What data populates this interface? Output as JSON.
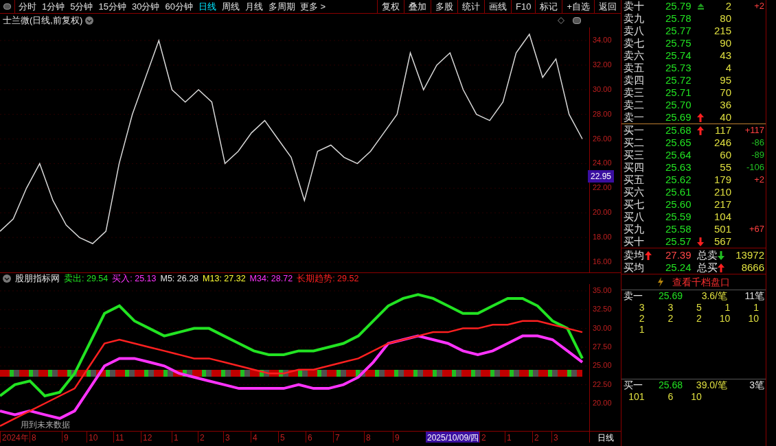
{
  "toolbar": {
    "periods": [
      {
        "label": "分时",
        "selected": false
      },
      {
        "label": "1分钟",
        "selected": false
      },
      {
        "label": "5分钟",
        "selected": false
      },
      {
        "label": "15分钟",
        "selected": false
      },
      {
        "label": "30分钟",
        "selected": false
      },
      {
        "label": "60分钟",
        "selected": false
      },
      {
        "label": "日线",
        "selected": true
      },
      {
        "label": "周线",
        "selected": false
      },
      {
        "label": "月线",
        "selected": false
      },
      {
        "label": "多周期",
        "selected": false
      }
    ],
    "more": "更多 >",
    "actions": [
      "复权",
      "叠加",
      "多股",
      "统计",
      "画线",
      "F10",
      "标记",
      "+自选",
      "返回"
    ]
  },
  "chart": {
    "title": "士兰微(日线,前复权)",
    "price_tag": "22.95",
    "chart_data": {
      "type": "line",
      "grid": true,
      "ylim": [
        15.16,
        35.06
      ],
      "yticks": [
        {
          "value": 16,
          "label": "16.00"
        },
        {
          "value": 18,
          "label": "18.00"
        },
        {
          "value": 20,
          "label": "20.00"
        },
        {
          "value": 22,
          "label": "22.00"
        },
        {
          "value": 24,
          "label": "24.00"
        },
        {
          "value": 26,
          "label": "26.00"
        },
        {
          "value": 28,
          "label": "28.00"
        },
        {
          "value": 30,
          "label": "30.00"
        },
        {
          "value": 32,
          "label": "32.00"
        },
        {
          "value": 34,
          "label": "34.00"
        }
      ],
      "series": [
        {
          "color": "#d8d8d8",
          "values": [
            18.5,
            19.5,
            22,
            24,
            21,
            19,
            18,
            17.5,
            18.5,
            24,
            28,
            31,
            34,
            30,
            29,
            30,
            29,
            24,
            25,
            26.5,
            27.5,
            26,
            24.5,
            21,
            25,
            25.5,
            24.5,
            24,
            25,
            26.5,
            28,
            33,
            30,
            32,
            33,
            30,
            28,
            27.5,
            29,
            33,
            34.5,
            31,
            32.5,
            28,
            26
          ]
        }
      ]
    }
  },
  "indicator": {
    "name": "股朋指标网",
    "readings": [
      {
        "label": "卖出: 29.54",
        "color": "#22e322"
      },
      {
        "label": "买入: 25.13",
        "color": "#ff33ff"
      },
      {
        "label": "M5: 26.28",
        "color": "#e8e8e8"
      },
      {
        "label": "M13: 27.32",
        "color": "#ffff33"
      },
      {
        "label": "M34: 28.72",
        "color": "#ff33ff"
      },
      {
        "label": "长期趋势: 29.52",
        "color": "#ff2020"
      }
    ],
    "note": "用到未来数据",
    "chart_data": {
      "type": "line",
      "grid": true,
      "ylim": [
        16.34,
        35.91
      ],
      "yticks": [
        {
          "value": 20,
          "label": "20.00"
        },
        {
          "value": 22.5,
          "label": "22.50"
        },
        {
          "value": 25,
          "label": "25.00"
        },
        {
          "value": 27.5,
          "label": "27.50"
        },
        {
          "value": 30,
          "label": "30.00"
        },
        {
          "value": 32.5,
          "label": "32.50"
        },
        {
          "value": 35,
          "label": "35.00"
        }
      ],
      "series": [
        {
          "color": "#22e322",
          "values": [
            21,
            22.5,
            23,
            21,
            21.5,
            24,
            28,
            32,
            33,
            31,
            30,
            29,
            29.5,
            30,
            30,
            29,
            28,
            27,
            26.5,
            26.5,
            27,
            27,
            27.5,
            28,
            29,
            31,
            33,
            34,
            34.5,
            34,
            33,
            32,
            32,
            33,
            34,
            34,
            33,
            31,
            30,
            26
          ]
        },
        {
          "color": "#ff33ff",
          "values": [
            19,
            18.5,
            19,
            18.5,
            18,
            19,
            22,
            25,
            26,
            26,
            25.5,
            25,
            24,
            23.5,
            23,
            22.5,
            22,
            22,
            22,
            22,
            22.5,
            22,
            22,
            22.5,
            23.5,
            25.5,
            28,
            28.5,
            29,
            28.5,
            28,
            27,
            26.5,
            27,
            28,
            29,
            29,
            28.5,
            27,
            25.5
          ]
        },
        {
          "color": "#ff2020",
          "values": [
            17,
            18,
            19,
            20,
            21,
            22,
            25,
            28,
            28.5,
            28,
            27.5,
            27,
            26.5,
            26,
            26,
            25.5,
            25,
            24.5,
            24,
            24,
            24.5,
            24.5,
            25,
            25.5,
            26,
            27,
            28,
            28.5,
            29,
            29.5,
            29.5,
            30,
            30,
            30.5,
            30.5,
            31,
            31,
            30.5,
            30,
            29.5
          ]
        }
      ]
    }
  },
  "x_axis": {
    "labels": [
      "2024年",
      "8",
      "9",
      "10",
      "11",
      "12",
      "1",
      "2",
      "3",
      "4",
      "5",
      "6",
      "7",
      "8",
      "9"
    ],
    "cursor_date": "2025/10/09/四",
    "labels_after": [
      "2",
      "1",
      "2",
      "3"
    ],
    "period": "日线"
  },
  "order_book": {
    "asks": [
      {
        "label": "卖十",
        "price": "25.79",
        "volume": "2",
        "change": "+2",
        "color": "#ff4040",
        "arrow": {
          "kind": "flat",
          "color": "#1e9a1e"
        }
      },
      {
        "label": "卖九",
        "price": "25.78",
        "volume": "80"
      },
      {
        "label": "卖八",
        "price": "25.77",
        "volume": "215"
      },
      {
        "label": "卖七",
        "price": "25.75",
        "volume": "90"
      },
      {
        "label": "卖六",
        "price": "25.74",
        "volume": "43"
      },
      {
        "label": "卖五",
        "price": "25.73",
        "volume": "4"
      },
      {
        "label": "卖四",
        "price": "25.72",
        "volume": "95"
      },
      {
        "label": "卖三",
        "price": "25.71",
        "volume": "70"
      },
      {
        "label": "卖二",
        "price": "25.70",
        "volume": "36"
      },
      {
        "label": "卖一",
        "price": "25.69",
        "volume": "40",
        "arrow": {
          "kind": "up",
          "color": "#ff2020"
        }
      }
    ],
    "bids": [
      {
        "label": "买一",
        "price": "25.68",
        "volume": "117",
        "change": "+117",
        "color": "#ff4040",
        "arrow": {
          "kind": "up",
          "color": "#ff2020"
        }
      },
      {
        "label": "买二",
        "price": "25.65",
        "volume": "246",
        "change": "-86",
        "color": "#22c022"
      },
      {
        "label": "买三",
        "price": "25.64",
        "volume": "60",
        "change": "-89",
        "color": "#22c022"
      },
      {
        "label": "买四",
        "price": "25.63",
        "volume": "55",
        "change": "-106",
        "color": "#22c022"
      },
      {
        "label": "买五",
        "price": "25.62",
        "volume": "179",
        "change": "+2",
        "color": "#ff4040"
      },
      {
        "label": "买六",
        "price": "25.61",
        "volume": "210"
      },
      {
        "label": "买七",
        "price": "25.60",
        "volume": "217"
      },
      {
        "label": "买八",
        "price": "25.59",
        "volume": "104"
      },
      {
        "label": "买九",
        "price": "25.58",
        "volume": "501",
        "change": "+67",
        "color": "#ff4040"
      },
      {
        "label": "买十",
        "price": "25.57",
        "volume": "567",
        "arrow": {
          "kind": "down",
          "color": "#ff2020"
        }
      }
    ],
    "summary": [
      {
        "label": "卖均",
        "arrow": {
          "kind": "up",
          "color": "#ff2020"
        },
        "value": "27.39",
        "color": "#ff4848",
        "total_label": "总卖",
        "total_arrow": {
          "kind": "down",
          "color": "#22c022"
        },
        "total": "13972"
      },
      {
        "label": "买均",
        "value": "25.24",
        "color": "#22e322",
        "total_label": "总买",
        "total_arrow": {
          "kind": "up",
          "color": "#ff2020"
        },
        "total": "8666"
      }
    ]
  },
  "depth": {
    "button": "查看千档盘口",
    "sell": {
      "label": "卖一",
      "price": "25.69",
      "avg": "3.6/笔",
      "count": "11笔",
      "orders": [
        "3",
        "3",
        "5",
        "1",
        "1",
        "2",
        "2",
        "2",
        "10",
        "10",
        "1"
      ]
    },
    "buy": {
      "label": "买一",
      "price": "25.68",
      "avg": "39.0/笔",
      "count": "3笔",
      "orders": [
        "101",
        "6",
        "10"
      ]
    }
  }
}
